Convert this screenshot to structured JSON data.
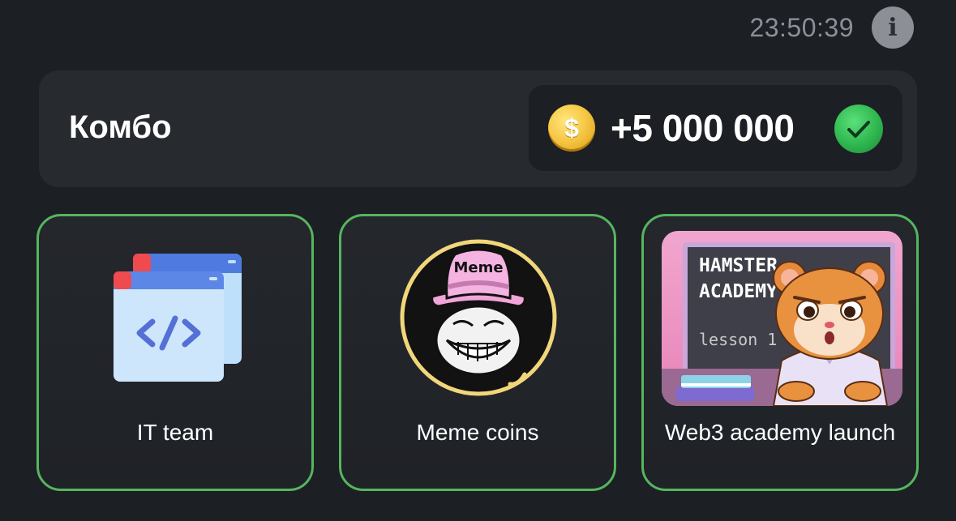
{
  "header": {
    "time": "23:50:39",
    "info_icon": "info-icon"
  },
  "combo": {
    "title": "Комбо",
    "reward": {
      "coin_icon": "coin-icon",
      "coin_symbol": "$",
      "value": "+5 000 000",
      "status_icon": "check-circle-icon"
    }
  },
  "cards": [
    {
      "label": "IT team",
      "icon": "code-window-icon"
    },
    {
      "label": "Meme coins",
      "icon": "meme-troll-hat-icon",
      "hat_text": "Meme"
    },
    {
      "label": "Web3 academy launch",
      "icon": "hamster-academy-image",
      "board_lines": [
        "HAMSTER",
        "ACADEMY",
        "lesson 1"
      ]
    }
  ],
  "colors": {
    "background": "#1c1f24",
    "panel": "#272a2f",
    "card_border": "#56b55f",
    "coin": "#f7c948",
    "check": "#2fb64f",
    "time_text": "#8b9099"
  }
}
